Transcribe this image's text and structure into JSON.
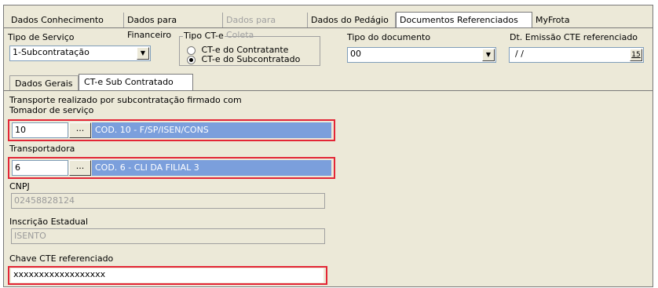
{
  "top_tabs": [
    {
      "label": "Dados Conhecimento",
      "state": "normal"
    },
    {
      "label": "Dados para Financeiro",
      "state": "normal"
    },
    {
      "label": "Dados para Coleta",
      "state": "disabled"
    },
    {
      "label": "Dados do Pedágio",
      "state": "normal"
    },
    {
      "label": "Documentos Referenciados",
      "state": "active"
    },
    {
      "label": "MyFrota",
      "state": "normal"
    }
  ],
  "tipo_servico": {
    "label": "Tipo de Serviço",
    "value": "1-Subcontratação"
  },
  "tipo_cte": {
    "label": "Tipo CT-e",
    "options": [
      {
        "label": "CT-e do Contratante",
        "checked": false
      },
      {
        "label": "CT-e do Subcontratado",
        "checked": true
      }
    ]
  },
  "tipo_documento": {
    "label": "Tipo do documento",
    "value": "00"
  },
  "dt_emissao": {
    "label": "Dt. Emissão CTE referenciado",
    "value": "/ /",
    "button_label": "15"
  },
  "inner_tabs": [
    {
      "label": "Dados Gerais",
      "active": false
    },
    {
      "label": "CT-e Sub Contratado",
      "active": true
    }
  ],
  "subcontratacao": {
    "header": "Transporte realizado por subcontratação firmado com",
    "tomador": {
      "label": "Tomador de serviço",
      "code": "10",
      "button": "...",
      "description": "COD. 10 - F/SP/ISEN/CONS"
    },
    "transportadora": {
      "label": "Transportadora",
      "code": "6",
      "button": "...",
      "description": "COD. 6 - CLI DA FILIAL 3"
    },
    "cnpj": {
      "label": "CNPJ",
      "value": "02458828124"
    },
    "inscricao": {
      "label": "Inscrição Estadual",
      "value": "ISENTO"
    },
    "chave": {
      "label": "Chave CTE referenciado",
      "value": "xxxxxxxxxxxxxxxxxx"
    }
  },
  "colors": {
    "highlight_border": "#e32636",
    "description_bg": "#7b9fdc",
    "window_bg": "#ece9d8"
  }
}
